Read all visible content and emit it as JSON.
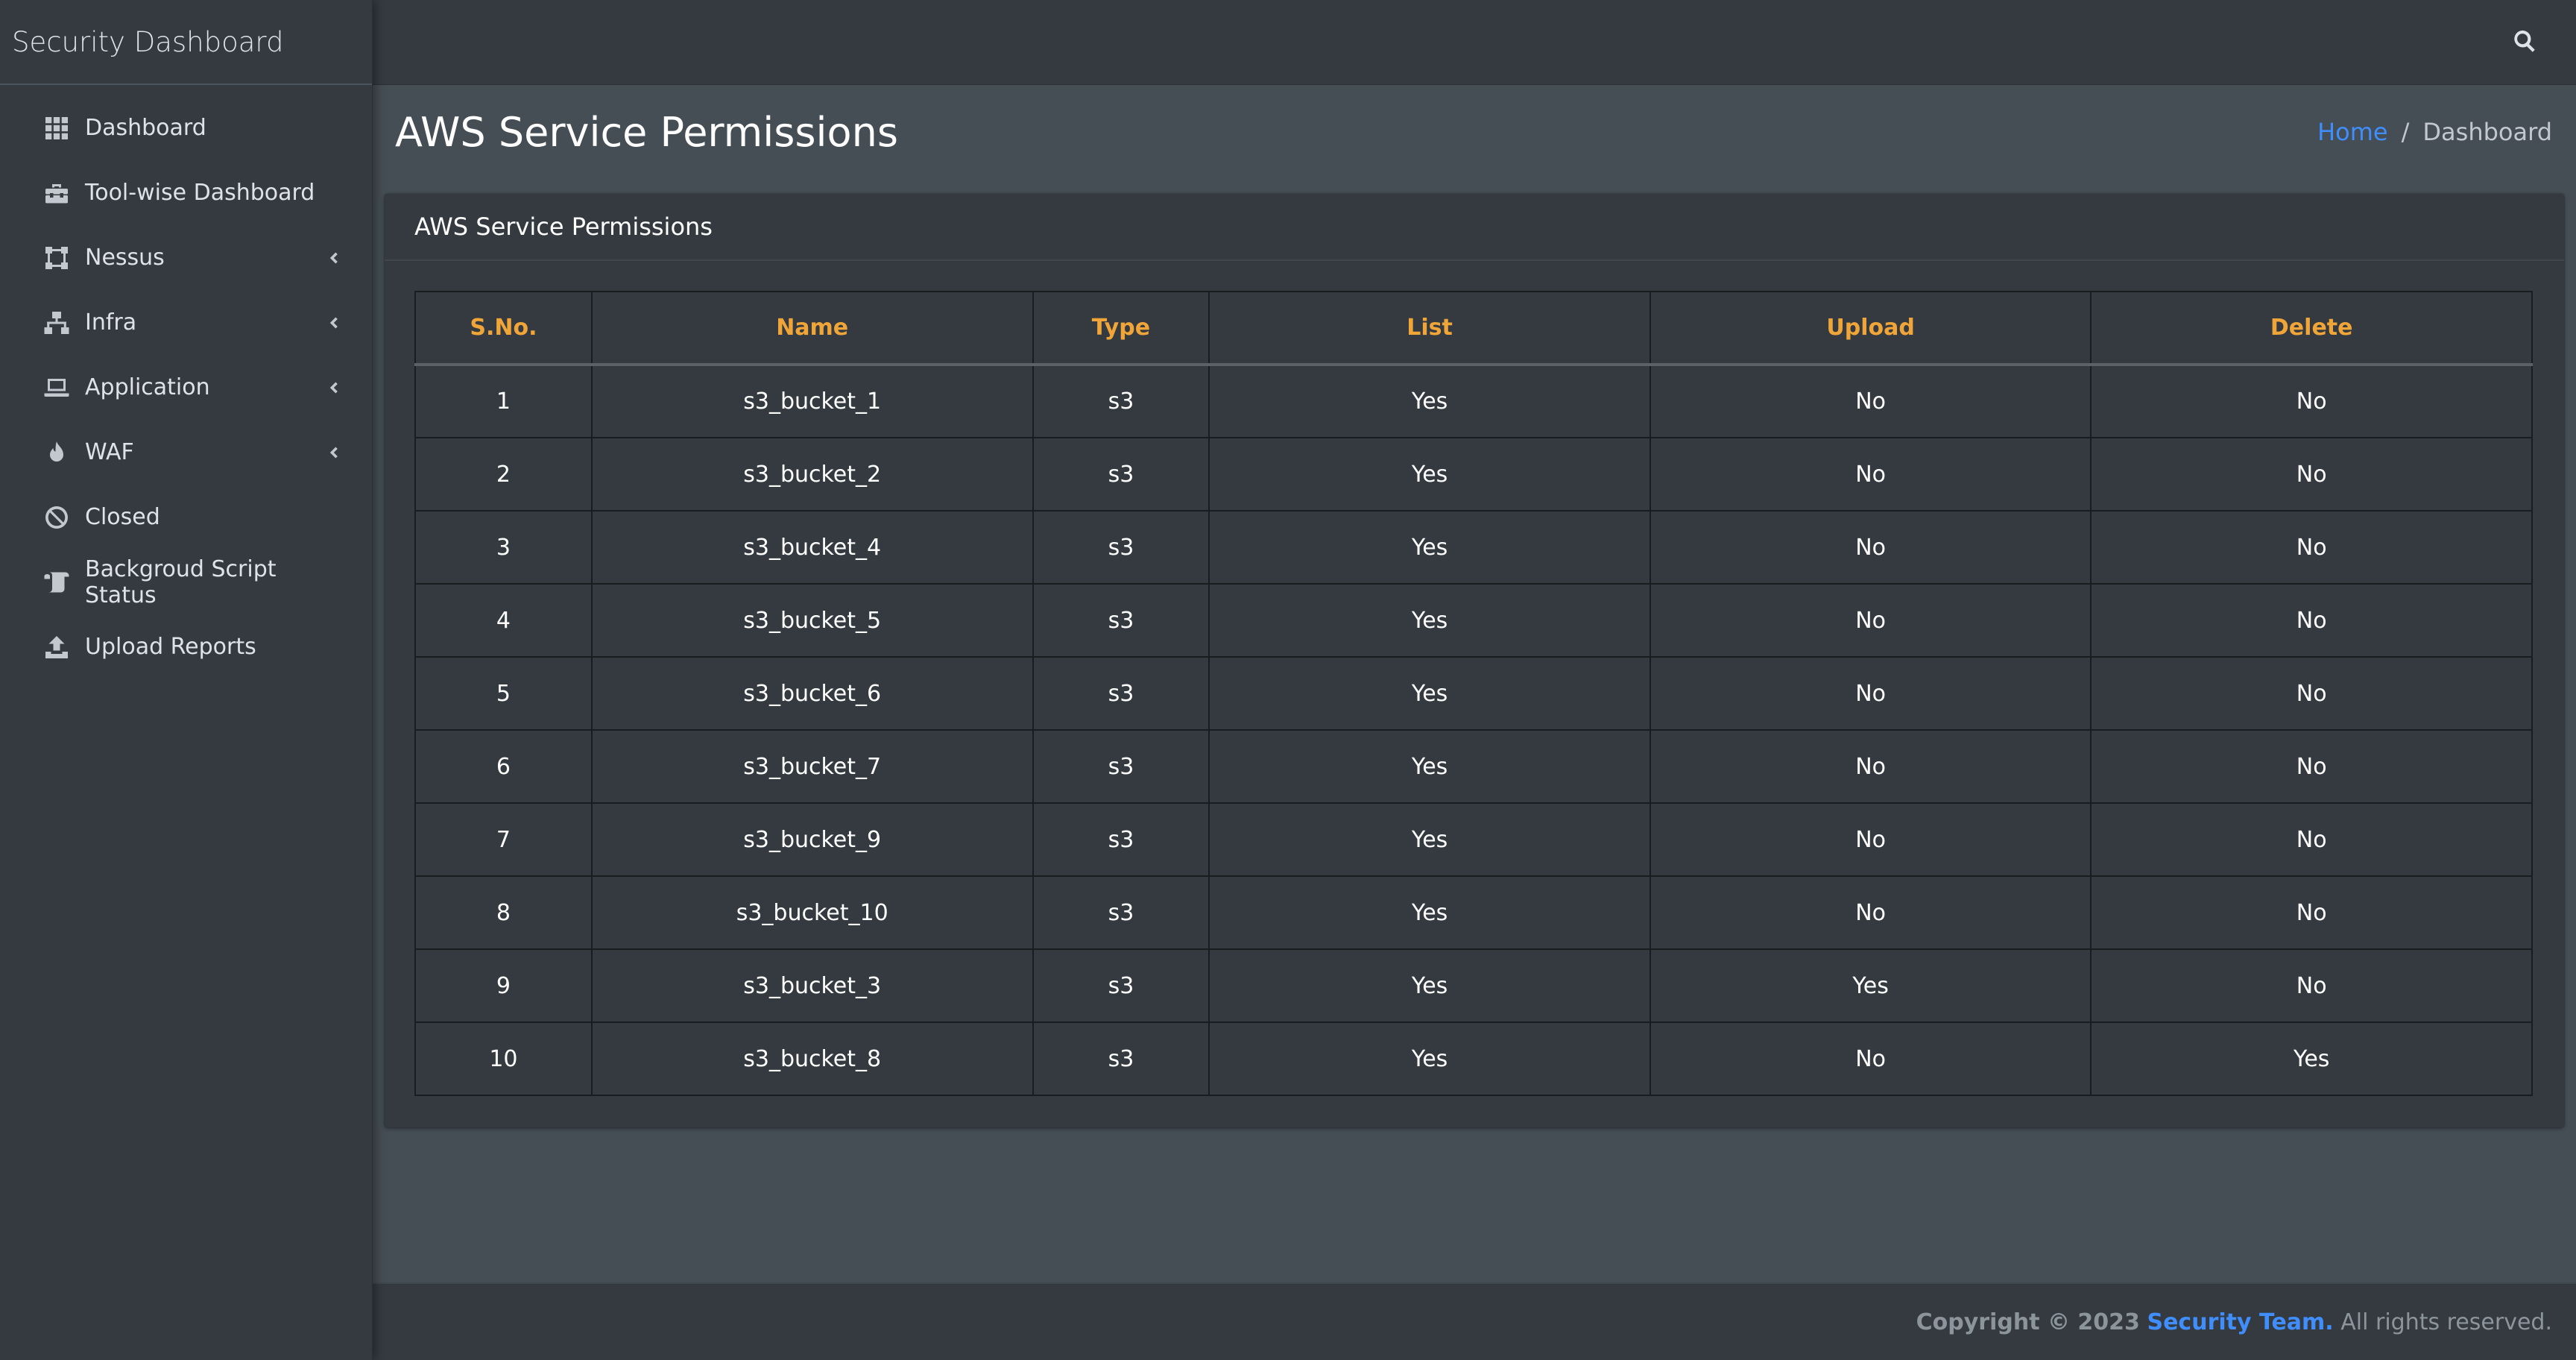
{
  "brand": "Security Dashboard",
  "sidebar": {
    "items": [
      {
        "label": "Dashboard",
        "icon": "grid-icon"
      },
      {
        "label": "Tool-wise Dashboard",
        "icon": "toolbox-icon"
      },
      {
        "label": "Nessus",
        "icon": "vector-square-icon",
        "has_submenu": true
      },
      {
        "label": "Infra",
        "icon": "network-icon",
        "has_submenu": true
      },
      {
        "label": "Application",
        "icon": "laptop-icon",
        "has_submenu": true
      },
      {
        "label": "WAF",
        "icon": "fire-icon",
        "has_submenu": true
      },
      {
        "label": "Closed",
        "icon": "ban-icon"
      },
      {
        "label": "Backgroud Script Status",
        "icon": "scroll-icon"
      },
      {
        "label": "Upload Reports",
        "icon": "upload-icon"
      }
    ]
  },
  "header": {
    "title": "AWS Service Permissions",
    "breadcrumb": {
      "home": "Home",
      "separator": "/",
      "current": "Dashboard"
    }
  },
  "card": {
    "title": "AWS Service Permissions"
  },
  "table": {
    "columns": [
      "S.No.",
      "Name",
      "Type",
      "List",
      "Upload",
      "Delete"
    ],
    "rows": [
      [
        "1",
        "s3_bucket_1",
        "s3",
        "Yes",
        "No",
        "No"
      ],
      [
        "2",
        "s3_bucket_2",
        "s3",
        "Yes",
        "No",
        "No"
      ],
      [
        "3",
        "s3_bucket_4",
        "s3",
        "Yes",
        "No",
        "No"
      ],
      [
        "4",
        "s3_bucket_5",
        "s3",
        "Yes",
        "No",
        "No"
      ],
      [
        "5",
        "s3_bucket_6",
        "s3",
        "Yes",
        "No",
        "No"
      ],
      [
        "6",
        "s3_bucket_7",
        "s3",
        "Yes",
        "No",
        "No"
      ],
      [
        "7",
        "s3_bucket_9",
        "s3",
        "Yes",
        "No",
        "No"
      ],
      [
        "8",
        "s3_bucket_10",
        "s3",
        "Yes",
        "No",
        "No"
      ],
      [
        "9",
        "s3_bucket_3",
        "s3",
        "Yes",
        "Yes",
        "No"
      ],
      [
        "10",
        "s3_bucket_8",
        "s3",
        "Yes",
        "No",
        "Yes"
      ]
    ]
  },
  "footer": {
    "copyright": "Copyright © 2023",
    "team": "Security Team.",
    "rights": "All rights reserved."
  },
  "colors": {
    "header_accent": "#f0a538",
    "link": "#3f8efc",
    "sidebar_bg": "#343a40",
    "content_bg": "#454d55"
  }
}
